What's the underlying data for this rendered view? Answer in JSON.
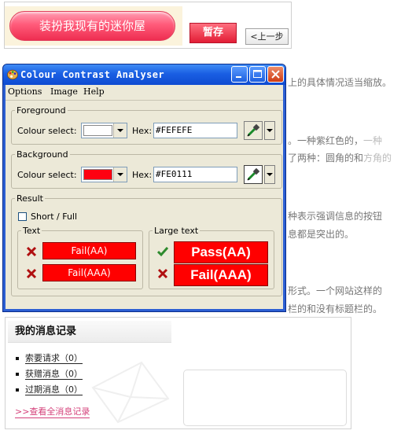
{
  "page": {
    "dressup_label": "装扮我现有的迷你屋",
    "save_label": "暂存",
    "back_label": "<上一步",
    "side_texts": [
      {
        "text": "上的具体情况适当缩放。",
        "faint": ""
      },
      {
        "text": "。一种紫红色的，",
        "faint": "一种"
      },
      {
        "text": "了两种：圆角的和",
        "faint": "方角的"
      },
      {
        "text": "种表示强调信息的按钮",
        "faint": ""
      },
      {
        "text": "息都是突出的。",
        "faint": ""
      },
      {
        "text": "形式。一个网站这样的",
        "faint": ""
      },
      {
        "text": "栏的和没有标题栏的。",
        "faint": ""
      }
    ],
    "messages": {
      "title": "我的消息记录",
      "items": [
        {
          "label": "索要请求",
          "count": "（0）"
        },
        {
          "label": "获赠消息",
          "count": "（0）"
        },
        {
          "label": "过期消息",
          "count": "（0）"
        }
      ],
      "view_all": ">>查看全消息记录"
    }
  },
  "app": {
    "title": "Colour Contrast Analyser",
    "menu": [
      "Options",
      "Image",
      "Help"
    ],
    "foreground": {
      "legend": "Foreground",
      "colour_label": "Colour select:",
      "hex_label": "Hex:",
      "hex_value": "#FEFEFE",
      "colour": "#FEFEFE"
    },
    "background": {
      "legend": "Background",
      "colour_label": "Colour select:",
      "hex_label": "Hex:",
      "hex_value": "#FE0111",
      "colour": "#FE0111"
    },
    "result": {
      "legend": "Result",
      "short_full_label": "Short / Full",
      "short_full_checked": false,
      "text_legend": "Text",
      "large_text_legend": "Large text",
      "text_results": [
        {
          "label": "Fail(AA)",
          "pass": false
        },
        {
          "label": "Fail(AAA)",
          "pass": false
        }
      ],
      "large_text_results": [
        {
          "label": "Pass(AA)",
          "pass": true
        },
        {
          "label": "Fail(AAA)",
          "pass": false
        }
      ]
    },
    "colors": {
      "pass": "#2e8b2e",
      "fail": "#b01010",
      "result_bg": "#FF0000"
    }
  }
}
